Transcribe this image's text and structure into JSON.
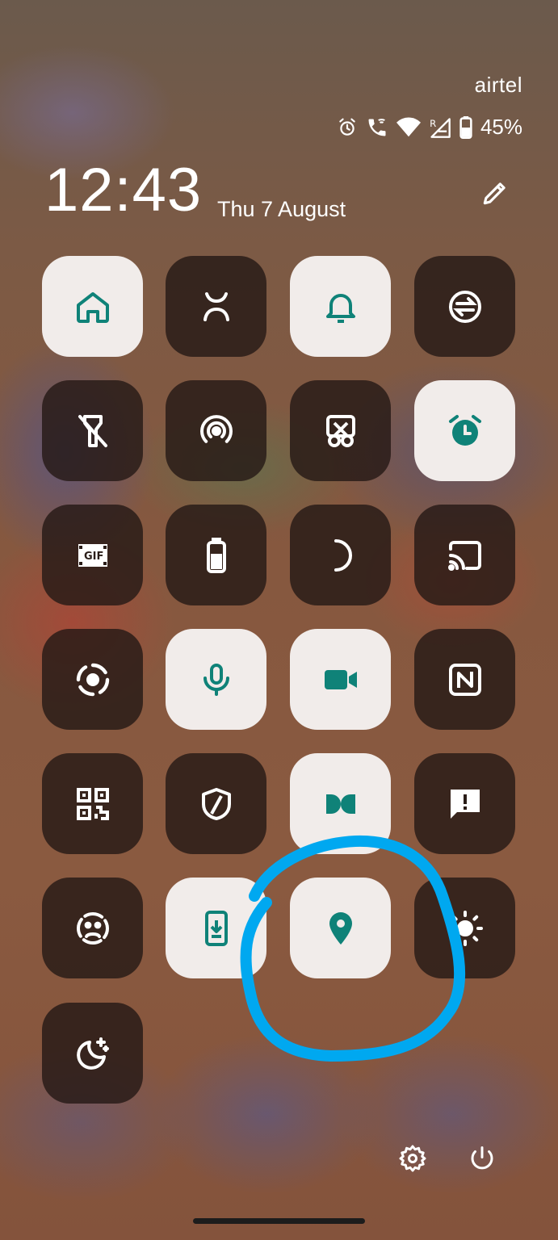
{
  "status_bar": {
    "carrier": "airtel",
    "battery_percent": "45%",
    "icons": [
      "alarm-icon",
      "wifi-calling-icon",
      "wifi-icon",
      "roaming-signal-icon",
      "battery-icon"
    ]
  },
  "header": {
    "time": "12:43",
    "date": "Thu 7 August",
    "edit_icon": "pencil-icon"
  },
  "colors": {
    "accent": "#0f8278",
    "tile_on": "#f1ecea",
    "tile_off": "#2a1d18",
    "annotation": "#00a8f0"
  },
  "tiles": [
    {
      "icon": "home-icon",
      "state": "on"
    },
    {
      "icon": "face-unlock-icon",
      "state": "off"
    },
    {
      "icon": "bell-icon",
      "state": "on"
    },
    {
      "icon": "data-saver-sync-icon",
      "state": "off"
    },
    {
      "icon": "flashlight-off-icon",
      "state": "off"
    },
    {
      "icon": "hotspot-icon",
      "state": "off"
    },
    {
      "icon": "screenshot-scissors-icon",
      "state": "off"
    },
    {
      "icon": "alarm-clock-icon",
      "state": "on"
    },
    {
      "icon": "gif-icon",
      "state": "off"
    },
    {
      "icon": "battery-saver-icon",
      "state": "off"
    },
    {
      "icon": "night-mode-icon",
      "state": "off"
    },
    {
      "icon": "cast-icon",
      "state": "off"
    },
    {
      "icon": "screen-record-icon",
      "state": "off"
    },
    {
      "icon": "microphone-icon",
      "state": "on"
    },
    {
      "icon": "camera-icon",
      "state": "on"
    },
    {
      "icon": "nfc-icon",
      "state": "off"
    },
    {
      "icon": "qr-scanner-icon",
      "state": "off"
    },
    {
      "icon": "shield-icon",
      "state": "off"
    },
    {
      "icon": "dolby-icon",
      "state": "on"
    },
    {
      "icon": "feedback-icon",
      "state": "off"
    },
    {
      "icon": "face-scan-icon",
      "state": "off"
    },
    {
      "icon": "phone-download-icon",
      "state": "on"
    },
    {
      "icon": "location-icon",
      "state": "on"
    },
    {
      "icon": "brightness-icon",
      "state": "off"
    },
    {
      "icon": "bedtime-icon",
      "state": "off"
    }
  ],
  "footer": {
    "icons": [
      "settings-icon",
      "power-icon"
    ]
  }
}
